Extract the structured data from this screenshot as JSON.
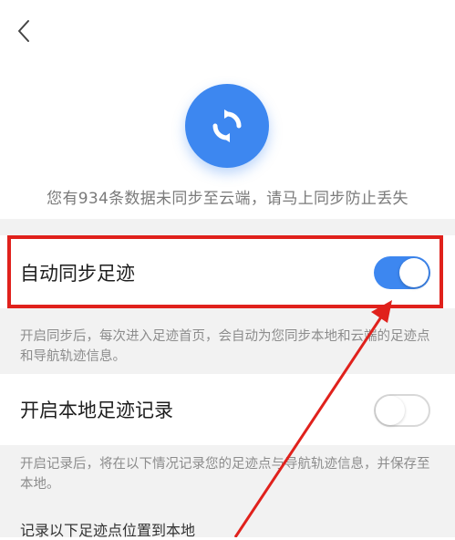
{
  "header": {
    "back_icon": "chevron-left-icon"
  },
  "hero": {
    "icon": "sync-icon",
    "message": "您有934条数据未同步至云端，请马上同步防止丢失"
  },
  "settings": {
    "auto_sync": {
      "label": "自动同步足迹",
      "enabled": true,
      "description": "开启同步后，每次进入足迹首页，会自动为您同步本地和云端的足迹点和导航轨迹信息。"
    },
    "local_record": {
      "label": "开启本地足迹记录",
      "enabled": false,
      "description": "开启记录后，将在以下情况记录您的足迹点与导航轨迹信息，并保存至本地。"
    },
    "record_section_title": "记录以下足迹点位置到本地"
  },
  "colors": {
    "accent": "#3d87f0",
    "highlight": "#e0211c",
    "band": "#f2f2f2"
  }
}
